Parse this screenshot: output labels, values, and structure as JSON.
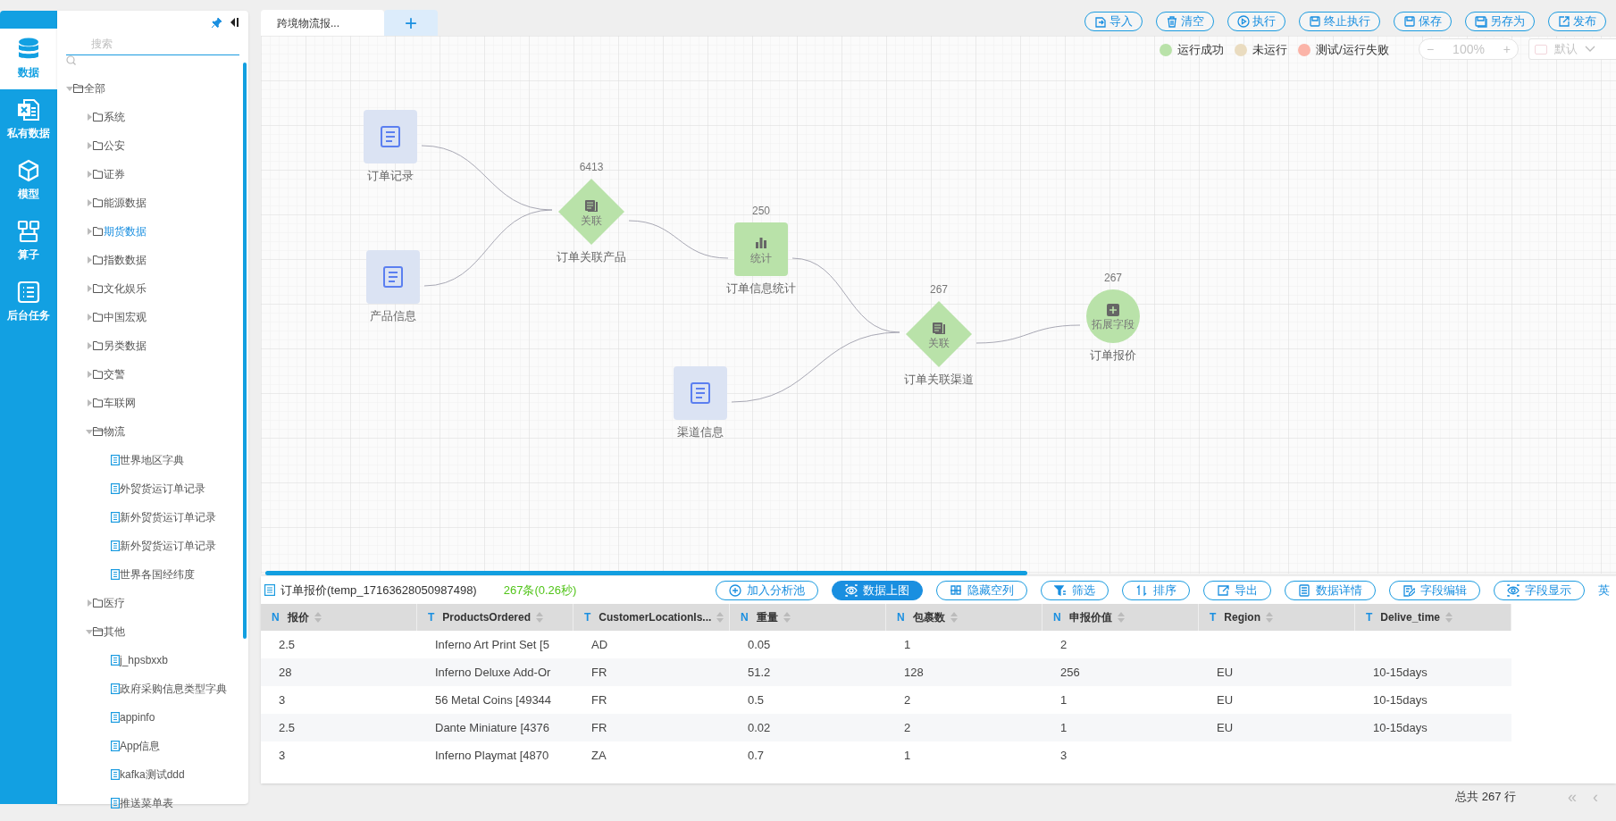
{
  "rail": [
    {
      "label": "数据",
      "selected": true
    },
    {
      "label": "私有数据",
      "selected": false
    },
    {
      "label": "模型",
      "selected": false
    },
    {
      "label": "算子",
      "selected": false
    },
    {
      "label": "后台任务",
      "selected": false
    }
  ],
  "tree": {
    "search_placeholder": "搜索",
    "items": [
      {
        "label": "全部",
        "kind": "folder",
        "expanded": true,
        "selected": false,
        "children": [
          {
            "label": "系统",
            "kind": "folder",
            "expanded": false,
            "selected": false
          },
          {
            "label": "公安",
            "kind": "folder",
            "expanded": false,
            "selected": false
          },
          {
            "label": "证券",
            "kind": "folder",
            "expanded": false,
            "selected": false
          },
          {
            "label": "能源数据",
            "kind": "folder",
            "expanded": false,
            "selected": false
          },
          {
            "label": "期货数据",
            "kind": "folder",
            "expanded": false,
            "selected": true
          },
          {
            "label": "指数数据",
            "kind": "folder",
            "expanded": false,
            "selected": false
          },
          {
            "label": "文化娱乐",
            "kind": "folder",
            "expanded": false,
            "selected": false
          },
          {
            "label": "中国宏观",
            "kind": "folder",
            "expanded": false,
            "selected": false
          },
          {
            "label": "另类数据",
            "kind": "folder",
            "expanded": false,
            "selected": false
          },
          {
            "label": "交警",
            "kind": "folder",
            "expanded": false,
            "selected": false
          },
          {
            "label": "车联网",
            "kind": "folder",
            "expanded": false,
            "selected": false
          },
          {
            "label": "物流",
            "kind": "folder",
            "expanded": true,
            "selected": false,
            "children": [
              {
                "label": "世界地区字典",
                "kind": "file",
                "selected": false
              },
              {
                "label": "外贸货运订单记录",
                "kind": "file",
                "selected": false
              },
              {
                "label": "新外贸货运订单记录",
                "kind": "file",
                "selected": false
              },
              {
                "label": "新外贸货运订单记录",
                "kind": "file",
                "selected": false
              },
              {
                "label": "世界各国经纬度",
                "kind": "file",
                "selected": false
              }
            ]
          },
          {
            "label": "医疗",
            "kind": "folder",
            "expanded": false,
            "selected": false
          },
          {
            "label": "其他",
            "kind": "folder",
            "expanded": true,
            "selected": false,
            "children": [
              {
                "label": "j_hpsbxxb",
                "kind": "file",
                "selected": false
              },
              {
                "label": "政府采购信息类型字典",
                "kind": "file",
                "selected": false
              },
              {
                "label": "appinfo",
                "kind": "file",
                "selected": false
              },
              {
                "label": "App信息",
                "kind": "file",
                "selected": false
              },
              {
                "label": "kafka测试ddd",
                "kind": "file",
                "selected": false
              },
              {
                "label": "推送菜单表",
                "kind": "file",
                "selected": false
              }
            ]
          }
        ]
      }
    ]
  },
  "tabs": [
    {
      "label": "跨境物流报...",
      "selected": true
    }
  ],
  "add_tab": "+",
  "toolbar": [
    {
      "label": "导入"
    },
    {
      "label": "清空"
    },
    {
      "label": "执行"
    },
    {
      "label": "终止执行"
    },
    {
      "label": "保存"
    },
    {
      "label": "另存为"
    },
    {
      "label": "发布"
    }
  ],
  "legend": [
    {
      "label": "运行成功",
      "color": "#b9e2a9"
    },
    {
      "label": "未运行",
      "color": "#eadcc0"
    },
    {
      "label": "测试/运行失败",
      "color": "#fbb4a8"
    }
  ],
  "zoom": {
    "minus": "−",
    "value": "100%",
    "plus": "+"
  },
  "style_select": {
    "value": "默认"
  },
  "nodes": [
    {
      "kind": "source",
      "label": "订单记录"
    },
    {
      "kind": "source",
      "label": "产品信息"
    },
    {
      "kind": "join",
      "count": "6413",
      "inner": "关联",
      "label": "订单关联产品",
      "color": "#b9e2a9"
    },
    {
      "kind": "stats",
      "count": "250",
      "inner": "统计",
      "label": "订单信息统计",
      "color": "#b9e2a9"
    },
    {
      "kind": "source",
      "label": "渠道信息"
    },
    {
      "kind": "join",
      "count": "267",
      "inner": "关联",
      "label": "订单关联渠道",
      "color": "#b9e2a9"
    },
    {
      "kind": "extend",
      "count": "267",
      "inner": "拓展字段",
      "label": "订单报价",
      "color": "#b9e2a9"
    }
  ],
  "result": {
    "title": "订单报价(temp_17163628050987498)",
    "summary": "267条(0.26秒)",
    "buttons": [
      {
        "label": "加入分析池",
        "selected": false
      },
      {
        "label": "数据上图",
        "selected": true
      },
      {
        "label": "隐藏空列",
        "selected": false
      },
      {
        "label": "筛选",
        "selected": false
      },
      {
        "label": "排序",
        "selected": false
      },
      {
        "label": "导出",
        "selected": false
      },
      {
        "label": "数据详情",
        "selected": false
      },
      {
        "label": "字段编辑",
        "selected": false
      },
      {
        "label": "字段显示",
        "selected": false
      }
    ],
    "cut_button": "英",
    "columns": [
      {
        "type": "N",
        "label": "报价"
      },
      {
        "type": "T",
        "label": "ProductsOrdered"
      },
      {
        "type": "T",
        "label": "CustomerLocationIs..."
      },
      {
        "type": "N",
        "label": "重量"
      },
      {
        "type": "N",
        "label": "包裹数"
      },
      {
        "type": "N",
        "label": "申报价值"
      },
      {
        "type": "T",
        "label": "Region"
      },
      {
        "type": "T",
        "label": "Delive_time"
      }
    ],
    "rows": [
      [
        "2.5",
        "Inferno Art Print Set [5",
        "AD",
        "0.05",
        "1",
        "2",
        "",
        ""
      ],
      [
        "28",
        "Inferno Deluxe Add-Or",
        "FR",
        "51.2",
        "128",
        "256",
        "EU",
        "10-15days"
      ],
      [
        "3",
        "56 Metal Coins [49344",
        "FR",
        "0.5",
        "2",
        "1",
        "EU",
        "10-15days"
      ],
      [
        "2.5",
        "Dante Miniature [4376",
        "FR",
        "0.02",
        "2",
        "1",
        "EU",
        "10-15days"
      ],
      [
        "3",
        "Inferno Playmat [4870",
        "ZA",
        "0.7",
        "1",
        "3",
        "",
        ""
      ]
    ],
    "total": "总共 267 行",
    "first_page": "«",
    "prev_page": "‹"
  }
}
